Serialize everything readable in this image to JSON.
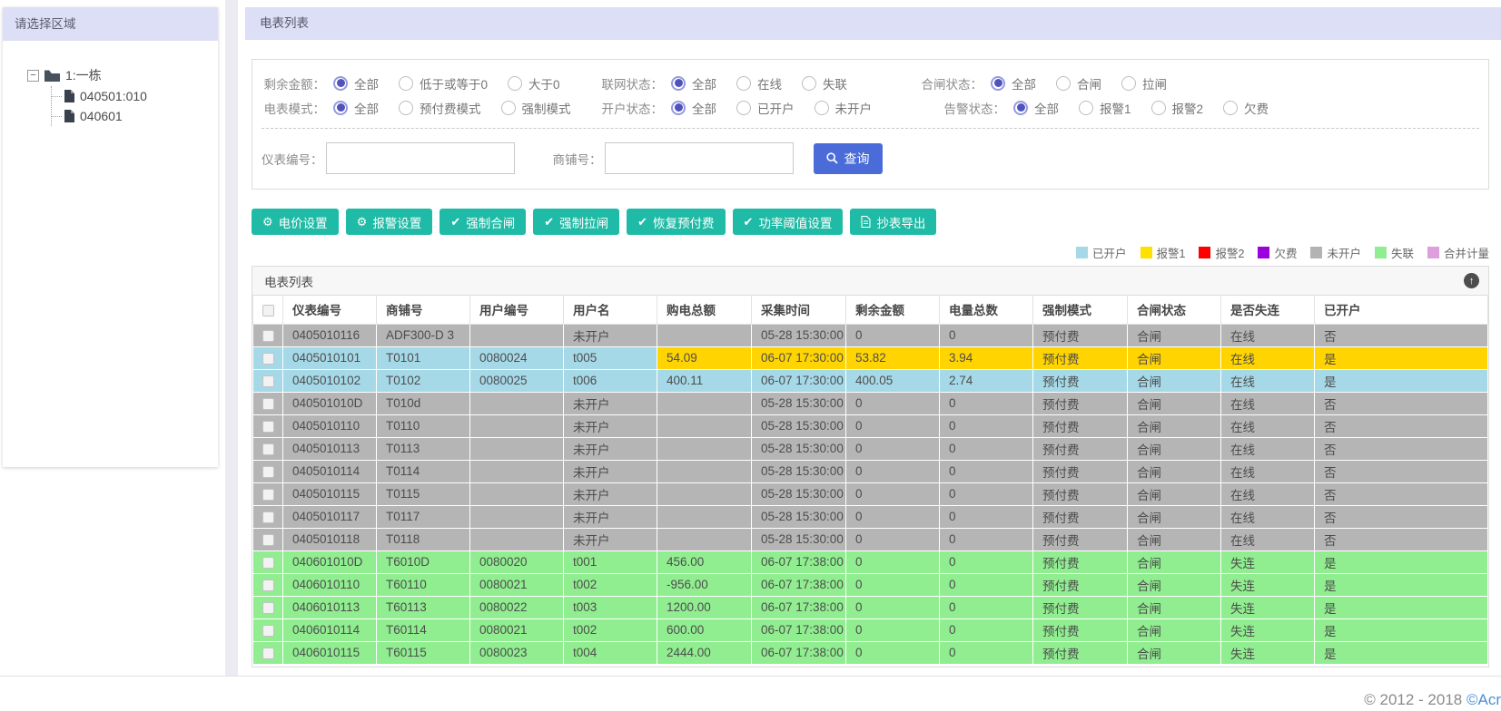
{
  "sidebar": {
    "title": "请选择区域",
    "tree": {
      "root": "1:一栋",
      "children": [
        "040501:010",
        "040601"
      ]
    }
  },
  "main": {
    "title": "电表列表",
    "filters": {
      "rows": [
        [
          {
            "label": "剩余金额：",
            "options": [
              {
                "label": "全部",
                "selected": true
              },
              {
                "label": "低于或等于0"
              },
              {
                "label": "大于0"
              }
            ]
          },
          {
            "label": "联网状态：",
            "options": [
              {
                "label": "全部",
                "selected": true
              },
              {
                "label": "在线"
              },
              {
                "label": "失联"
              }
            ]
          },
          {
            "label": "合闸状态：",
            "options": [
              {
                "label": "全部",
                "selected": true
              },
              {
                "label": "合闸"
              },
              {
                "label": "拉闸"
              }
            ]
          }
        ],
        [
          {
            "label": "电表模式：",
            "options": [
              {
                "label": "全部",
                "selected": true
              },
              {
                "label": "预付费模式"
              },
              {
                "label": "强制模式"
              }
            ]
          },
          {
            "label": "开户状态：",
            "options": [
              {
                "label": "全部",
                "selected": true
              },
              {
                "label": "已开户"
              },
              {
                "label": "未开户"
              }
            ]
          },
          {
            "label": "告警状态：",
            "options": [
              {
                "label": "全部",
                "selected": true
              },
              {
                "label": "报警1"
              },
              {
                "label": "报警2"
              },
              {
                "label": "欠费"
              }
            ]
          }
        ]
      ],
      "search": {
        "meter_label": "仪表编号：",
        "meter_value": "",
        "shop_label": "商铺号：",
        "shop_value": "",
        "query_label": "查询"
      }
    },
    "actions": [
      {
        "name": "electricity-price-settings",
        "icon": "gear",
        "label": "电价设置"
      },
      {
        "name": "alarm-settings",
        "icon": "gear",
        "label": "报警设置"
      },
      {
        "name": "force-close-switch",
        "icon": "check",
        "label": "强制合闸"
      },
      {
        "name": "force-open-switch",
        "icon": "check",
        "label": "强制拉闸"
      },
      {
        "name": "restore-prepaid",
        "icon": "check",
        "label": "恢复预付费"
      },
      {
        "name": "power-threshold-settings",
        "icon": "check",
        "label": "功率阈值设置"
      },
      {
        "name": "meter-reading-export",
        "icon": "doc",
        "label": "抄表导出"
      }
    ],
    "legend": [
      {
        "label": "已开户",
        "color": "#a6d9e8"
      },
      {
        "label": "报警1",
        "color": "#ffe100"
      },
      {
        "label": "报警2",
        "color": "#ff0000"
      },
      {
        "label": "欠费",
        "color": "#9a00e0"
      },
      {
        "label": "未开户",
        "color": "#b3b3b3"
      },
      {
        "label": "失联",
        "color": "#90ee90"
      },
      {
        "label": "合并计量",
        "color": "#dda0dd"
      }
    ],
    "table": {
      "panel_title": "电表列表",
      "collapse_icon": "↑",
      "row_colors": {
        "gray": "#b5b5b5",
        "blue": "#a6d9e8",
        "yellow": "#ffd400",
        "green": "#90ee90"
      },
      "columns": [
        "仪表编号",
        "商铺号",
        "用户编号",
        "用户名",
        "购电总额",
        "采集时间",
        "剩余金额",
        "电量总数",
        "强制模式",
        "合闸状态",
        "是否失连",
        "已开户"
      ],
      "rows": [
        {
          "bg": "gray",
          "cells": [
            "0405010116",
            "ADF300-D 3",
            "",
            "未开户",
            "",
            "05-28 15:30:00",
            "0",
            "0",
            "预付费",
            "合闸",
            "在线",
            "否"
          ]
        },
        {
          "bg": [
            "blue",
            "blue",
            "blue",
            "blue",
            "yellow",
            "yellow",
            "yellow",
            "yellow",
            "yellow",
            "yellow",
            "yellow",
            "yellow"
          ],
          "cells": [
            "0405010101",
            "T0101",
            "0080024",
            "t005",
            "54.09",
            "06-07 17:30:00",
            "53.82",
            "3.94",
            "预付费",
            "合闸",
            "在线",
            "是"
          ]
        },
        {
          "bg": "blue",
          "cells": [
            "0405010102",
            "T0102",
            "0080025",
            "t006",
            "400.11",
            "06-07 17:30:00",
            "400.05",
            "2.74",
            "预付费",
            "合闸",
            "在线",
            "是"
          ]
        },
        {
          "bg": "gray",
          "cells": [
            "040501010D",
            "T010d",
            "",
            "未开户",
            "",
            "05-28 15:30:00",
            "0",
            "0",
            "预付费",
            "合闸",
            "在线",
            "否"
          ]
        },
        {
          "bg": "gray",
          "cells": [
            "0405010110",
            "T0110",
            "",
            "未开户",
            "",
            "05-28 15:30:00",
            "0",
            "0",
            "预付费",
            "合闸",
            "在线",
            "否"
          ]
        },
        {
          "bg": "gray",
          "cells": [
            "0405010113",
            "T0113",
            "",
            "未开户",
            "",
            "05-28 15:30:00",
            "0",
            "0",
            "预付费",
            "合闸",
            "在线",
            "否"
          ]
        },
        {
          "bg": "gray",
          "cells": [
            "0405010114",
            "T0114",
            "",
            "未开户",
            "",
            "05-28 15:30:00",
            "0",
            "0",
            "预付费",
            "合闸",
            "在线",
            "否"
          ]
        },
        {
          "bg": "gray",
          "cells": [
            "0405010115",
            "T0115",
            "",
            "未开户",
            "",
            "05-28 15:30:00",
            "0",
            "0",
            "预付费",
            "合闸",
            "在线",
            "否"
          ]
        },
        {
          "bg": "gray",
          "cells": [
            "0405010117",
            "T0117",
            "",
            "未开户",
            "",
            "05-28 15:30:00",
            "0",
            "0",
            "预付费",
            "合闸",
            "在线",
            "否"
          ]
        },
        {
          "bg": "gray",
          "cells": [
            "0405010118",
            "T0118",
            "",
            "未开户",
            "",
            "05-28 15:30:00",
            "0",
            "0",
            "预付费",
            "合闸",
            "在线",
            "否"
          ]
        },
        {
          "bg": "green",
          "cells": [
            "040601010D",
            "T6010D",
            "0080020",
            "t001",
            "456.00",
            "06-07 17:38:00",
            "0",
            "0",
            "预付费",
            "合闸",
            "失连",
            "是"
          ]
        },
        {
          "bg": "green",
          "cells": [
            "0406010110",
            "T60110",
            "0080021",
            "t002",
            "-956.00",
            "06-07 17:38:00",
            "0",
            "0",
            "预付费",
            "合闸",
            "失连",
            "是"
          ]
        },
        {
          "bg": "green",
          "cells": [
            "0406010113",
            "T60113",
            "0080022",
            "t003",
            "1200.00",
            "06-07 17:38:00",
            "0",
            "0",
            "预付费",
            "合闸",
            "失连",
            "是"
          ]
        },
        {
          "bg": "green",
          "cells": [
            "0406010114",
            "T60114",
            "0080021",
            "t002",
            "600.00",
            "06-07 17:38:00",
            "0",
            "0",
            "预付费",
            "合闸",
            "失连",
            "是"
          ]
        },
        {
          "bg": "green",
          "cells": [
            "0406010115",
            "T60115",
            "0080023",
            "t004",
            "2444.00",
            "06-07 17:38:00",
            "0",
            "0",
            "预付费",
            "合闸",
            "失连",
            "是"
          ]
        }
      ]
    }
  },
  "footer": {
    "copyright": "© 2012 - 2018 ",
    "link": "©Acr"
  }
}
